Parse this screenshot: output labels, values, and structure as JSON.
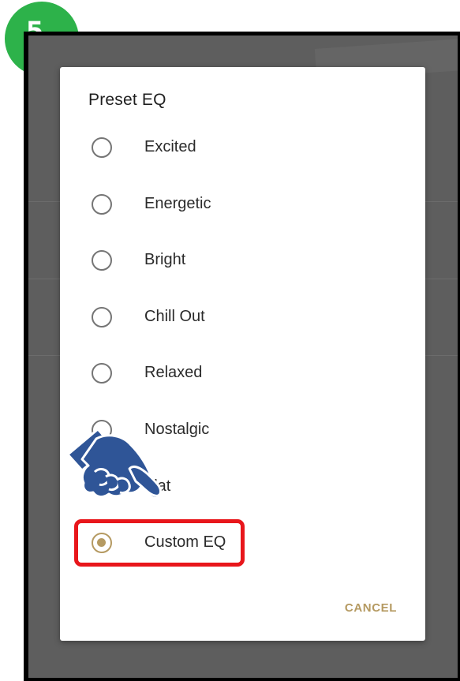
{
  "step_badge": {
    "number": "5",
    "color": "#2db24a"
  },
  "dialog": {
    "title": "Preset EQ",
    "options": [
      {
        "label": "Excited",
        "checked": false
      },
      {
        "label": "Energetic",
        "checked": false
      },
      {
        "label": "Bright",
        "checked": false
      },
      {
        "label": "Chill Out",
        "checked": false
      },
      {
        "label": "Relaxed",
        "checked": false
      },
      {
        "label": "Nostalgic",
        "checked": false
      },
      {
        "label": "Flat",
        "checked": false
      },
      {
        "label": "Custom EQ",
        "checked": true
      }
    ],
    "cancel_label": "CANCEL"
  },
  "colors": {
    "accent": "#b59a62",
    "highlight": "#e8161b",
    "pointer": "#2f5597"
  },
  "annotations": {
    "highlighted_option": "Custom EQ",
    "pointer_icon": "pointing-hand-icon"
  }
}
